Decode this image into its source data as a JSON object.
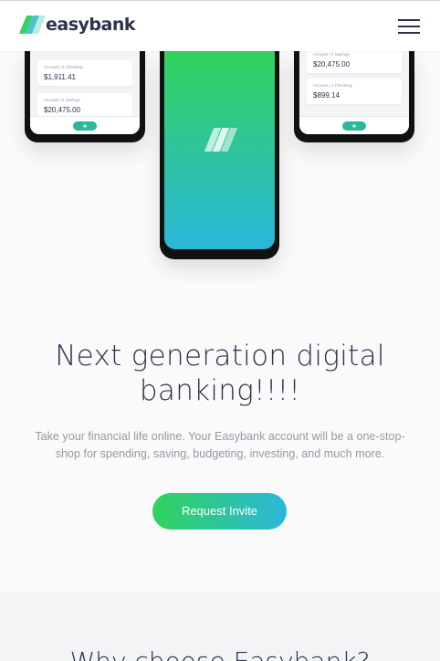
{
  "header": {
    "logo_text": "easybank",
    "menu_icon": "hamburger-menu-icon"
  },
  "phones": {
    "left": {
      "cards": [
        {
          "label": "Account | 3 Checking",
          "amount": "$1,911.41"
        },
        {
          "label": "Account | 2 Savings",
          "amount": "$20,475.00"
        }
      ],
      "fab_icon": "plus-icon",
      "fab_label": "+"
    },
    "right": {
      "cards": [
        {
          "label": "Account | 2 Savings",
          "amount": "$20,475.00"
        },
        {
          "label": "Account | 1 Checking",
          "amount": "$899.14"
        }
      ],
      "fab_icon": "plus-icon",
      "fab_label": "+"
    },
    "center": {
      "mark_icon": "easybank-logo-mark-icon"
    }
  },
  "hero": {
    "title": "Next generation digital banking!!!!",
    "subtitle": "Take your financial life online. Your Easybank account will be a one-stop-shop for spending, saving, budgeting, investing, and much more.",
    "cta_label": "Request Invite"
  },
  "why": {
    "title": "Why choose Easybank?"
  },
  "colors": {
    "dark_blue": "#2d314d",
    "lime_green": "#31d35c",
    "bright_cyan": "#2bb7da",
    "grayish_blue": "#9698a6",
    "light_gray": "#fafafa"
  }
}
